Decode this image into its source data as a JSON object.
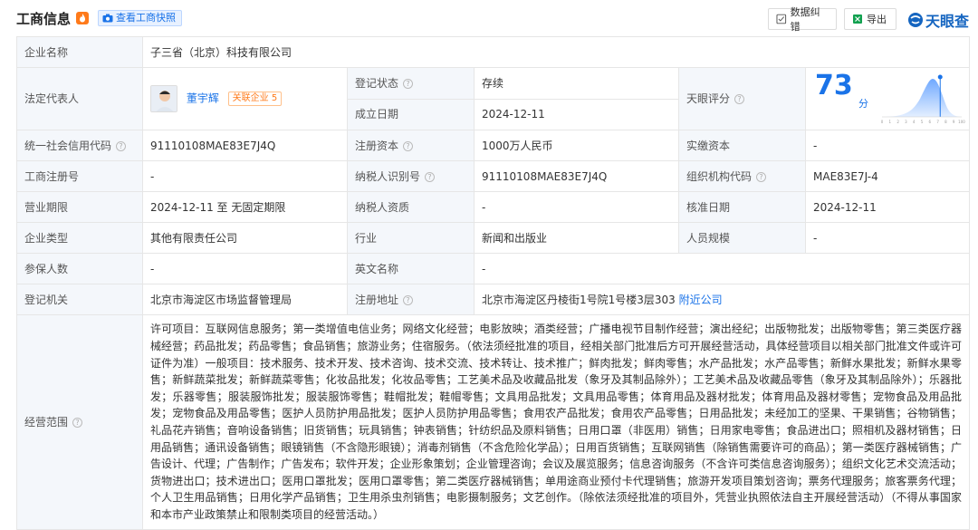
{
  "header": {
    "title": "工商信息",
    "snapshot_button": "查看工商快照",
    "correction_button": "数据纠错",
    "export_button": "导出",
    "logo_text": "天眼查"
  },
  "colors": {
    "accent": "#1a73e8",
    "status_green": "#12a150",
    "label_bg": "#f4f7fb",
    "orange": "#ff7a1a"
  },
  "rows": {
    "company_name_label": "企业名称",
    "company_name": "子三省（北京）科技有限公司",
    "legal_rep_label": "法定代表人",
    "legal_rep_name": "董宇辉",
    "legal_rep_assoc_label": "关联企业",
    "legal_rep_assoc_count": "5",
    "reg_status_label": "登记状态",
    "reg_status": "存续",
    "founded_label": "成立日期",
    "founded": "2024-12-11",
    "score_label": "天眼评分",
    "score": "73",
    "score_unit": "分",
    "credit_code_label": "统一社会信用代码",
    "credit_code": "91110108MAE83E7J4Q",
    "reg_capital_label": "注册资本",
    "reg_capital": "1000万人民币",
    "paid_capital_label": "实缴资本",
    "paid_capital": "-",
    "biz_reg_no_label": "工商注册号",
    "biz_reg_no": "-",
    "taxpayer_id_label": "纳税人识别号",
    "taxpayer_id": "91110108MAE83E7J4Q",
    "org_code_label": "组织机构代码",
    "org_code": "MAE83E7J-4",
    "term_label": "营业期限",
    "term": "2024-12-11 至 无固定期限",
    "taxpayer_qual_label": "纳税人资质",
    "taxpayer_qual": "-",
    "approval_date_label": "核准日期",
    "approval_date": "2024-12-11",
    "ent_type_label": "企业类型",
    "ent_type": "其他有限责任公司",
    "industry_label": "行业",
    "industry": "新闻和出版业",
    "staff_size_label": "人员规模",
    "staff_size": "-",
    "insured_label": "参保人数",
    "insured": "-",
    "english_name_label": "英文名称",
    "english_name": "-",
    "authority_label": "登记机关",
    "authority": "北京市海淀区市场监督管理局",
    "address_label": "注册地址",
    "address": "北京市海淀区丹棱街1号院1号楼3层303",
    "nearby_link": "附近公司",
    "scope_label": "经营范围",
    "scope": "许可项目：互联网信息服务；第一类增值电信业务；网络文化经营；电影放映；酒类经营；广播电视节目制作经营；演出经纪；出版物批发；出版物零售；第三类医疗器械经营；药品批发；药品零售；食品销售；旅游业务；住宿服务。（依法须经批准的项目，经相关部门批准后方可开展经营活动，具体经营项目以相关部门批准文件或许可证件为准）一般项目：技术服务、技术开发、技术咨询、技术交流、技术转让、技术推广；鲜肉批发；鲜肉零售；水产品批发；水产品零售；新鲜水果批发；新鲜水果零售；新鲜蔬菜批发；新鲜蔬菜零售；化妆品批发；化妆品零售；工艺美术品及收藏品批发（象牙及其制品除外）；工艺美术品及收藏品零售（象牙及其制品除外）；乐器批发；乐器零售；服装服饰批发；服装服饰零售；鞋帽批发；鞋帽零售；文具用品批发；文具用品零售；体育用品及器材批发；体育用品及器材零售；宠物食品及用品批发；宠物食品及用品零售；医护人员防护用品批发；医护人员防护用品零售；食用农产品批发；食用农产品零售；日用品批发；未经加工的坚果、干果销售；谷物销售；礼品花卉销售；音响设备销售；旧货销售；玩具销售；钟表销售；针纺织品及原料销售；日用口罩（非医用）销售；日用家电零售；食品进出口；照相机及器材销售；日用品销售；通讯设备销售；眼镜销售（不含隐形眼镜）；消毒剂销售（不含危险化学品）；日用百货销售；互联网销售（除销售需要许可的商品）；第一类医疗器械销售；广告设计、代理；广告制作；广告发布；软件开发；企业形象策划；企业管理咨询；会议及展览服务；信息咨询服务（不含许可类信息咨询服务）；组织文化艺术交流活动；货物进出口；技术进出口；医用口罩批发；医用口罩零售；第二类医疗器械销售；单用途商业预付卡代理销售；旅游开发项目策划咨询；票务代理服务；旅客票务代理；个人卫生用品销售；日用化学产品销售；卫生用杀虫剂销售；电影摄制服务；文艺创作。（除依法须经批准的项目外，凭营业执照依法自主开展经营活动）（不得从事国家和本市产业政策禁止和限制类项目的经营活动。）"
  },
  "score_chart": {
    "x_ticks": [
      "0",
      "1",
      "2",
      "3",
      "4",
      "5",
      "6",
      "7",
      "8",
      "9",
      "100"
    ],
    "marker_value": 73
  }
}
